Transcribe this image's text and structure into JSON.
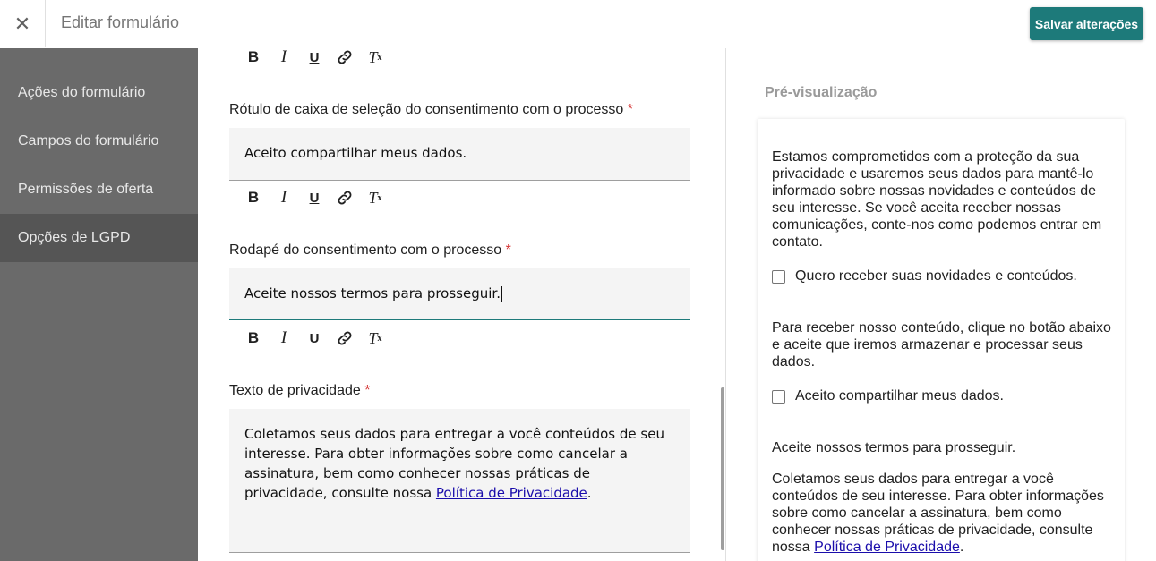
{
  "header": {
    "close_icon": "close-icon",
    "close_glyph": "✕",
    "title": "Editar formulário",
    "save_label": "Salvar alterações"
  },
  "sidebar": {
    "items": [
      {
        "label": "Ações do formulário",
        "active": false
      },
      {
        "label": "Campos do formulário",
        "active": false
      },
      {
        "label": "Permissões de oferta",
        "active": false
      },
      {
        "label": "Opções de LGPD",
        "active": true
      }
    ]
  },
  "editor": {
    "toolbar": {
      "bold": "B",
      "italic": "I",
      "underline": "U",
      "link": "link-icon",
      "clear": "T",
      "clear_sub": "x"
    },
    "consent_checkbox_label": {
      "label": "Rótulo de caixa de seleção do consentimento com o processo",
      "required": "*",
      "value": "Aceito compartilhar meus dados."
    },
    "consent_footer": {
      "label": "Rodapé do consentimento com o processo",
      "required": "*",
      "value": "Aceite nossos termos para prosseguir."
    },
    "privacy_text": {
      "label": "Texto de privacidade",
      "required": "*",
      "value_before_link": "Coletamos seus dados para entregar a você conteúdos de seu interesse. Para obter informações sobre como cancelar a assinatura, bem como conhecer nossas práticas de privacidade, consulte nossa ",
      "link_text": "Política de Privacidade",
      "value_after_link": "."
    }
  },
  "preview": {
    "title": "Pré-visualização",
    "intro": "Estamos comprometidos com a proteção da sua privacidade e usaremos seus dados para mantê-lo informado sobre nossas novidades e conteúdos de seu interesse. Se você aceita receber nossas comunicações, conte-nos como podemos entrar em contato.",
    "newsletter_checkbox": "Quero receber suas novidades e conteúdos.",
    "process_text": "Para receber nosso conteúdo, clique no botão abaixo e aceite que iremos armazenar e processar seus dados.",
    "consent_checkbox": "Aceito compartilhar meus dados.",
    "footer": "Aceite nossos termos para prosseguir.",
    "privacy_before_link": "Coletamos seus dados para entregar a você conteúdos de seu interesse. Para obter informações sobre como cancelar a assinatura, bem como conhecer nossas práticas de privacidade, consulte nossa ",
    "privacy_link": "Política de Privacidade",
    "privacy_after_link": "."
  },
  "colors": {
    "accent": "#1d7a7a",
    "sidebar_bg": "#6a6a6a",
    "sidebar_active": "#555555",
    "required": "#d32f2f",
    "link": "#1a0dab"
  }
}
